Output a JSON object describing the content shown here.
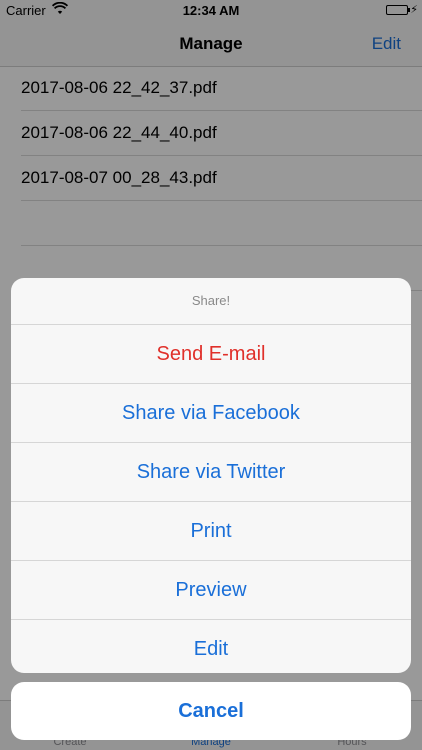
{
  "status_bar": {
    "carrier": "Carrier",
    "time": "12:34 AM"
  },
  "nav": {
    "title": "Manage",
    "edit_label": "Edit"
  },
  "files": [
    "2017-08-06 22_42_37.pdf",
    "2017-08-06 22_44_40.pdf",
    "2017-08-07 00_28_43.pdf"
  ],
  "tabs": [
    {
      "label": "Create"
    },
    {
      "label": "Manage"
    },
    {
      "label": "Hours"
    }
  ],
  "action_sheet": {
    "title": "Share!",
    "actions": [
      {
        "label": "Send E-mail"
      },
      {
        "label": "Share via Facebook"
      },
      {
        "label": "Share via Twitter"
      },
      {
        "label": "Print"
      },
      {
        "label": "Preview"
      },
      {
        "label": "Edit"
      }
    ],
    "cancel_label": "Cancel"
  },
  "colors": {
    "accent": "#1a6fd8",
    "destructive": "#e0302a",
    "battery": "#2fb345"
  }
}
